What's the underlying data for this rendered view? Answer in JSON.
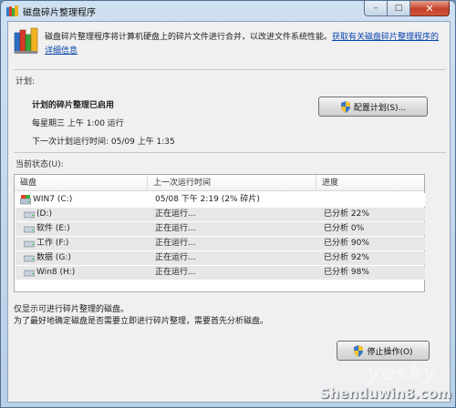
{
  "window": {
    "title": "磁盘碎片整理程序",
    "minimize_label": "–",
    "maximize_label": "□",
    "close_label": "✕"
  },
  "intro": {
    "text": "磁盘碎片整理程序将计算机硬盘上的碎片文件进行合并，以改进文件系统性能。",
    "link": "获取有关磁盘碎片整理程序的详细信息"
  },
  "schedule": {
    "section_label": "计划:",
    "enabled_text": "计划的碎片整理已启用",
    "frequency": "每星期三 上午 1:00 运行",
    "next_run": "下一次计划运行时间: 05/09 上午 1:35",
    "configure_button": "配置计划(S)..."
  },
  "status": {
    "section_label": "当前状态(U):",
    "columns": [
      "磁盘",
      "上一次运行时间",
      "进度"
    ],
    "rows": [
      {
        "disk": "WIN7 (C:)",
        "last_run": "05/08 下午 2:19 (2% 碎片)",
        "progress": ""
      },
      {
        "disk": "(D:)",
        "last_run": "正在运行...",
        "progress": "已分析 22%"
      },
      {
        "disk": "软件 (E:)",
        "last_run": "正在运行...",
        "progress": "已分析 0%"
      },
      {
        "disk": "工作 (F:)",
        "last_run": "正在运行...",
        "progress": "已分析 90%"
      },
      {
        "disk": "数据 (G:)",
        "last_run": "正在运行...",
        "progress": "已分析 92%"
      },
      {
        "disk": "Win8 (H:)",
        "last_run": "正在运行...",
        "progress": "已分析 98%"
      }
    ]
  },
  "footer": {
    "line1": "仅显示可进行碎片整理的磁盘。",
    "line2": "为了最好地确定磁盘是否需要立即进行碎片整理，需要首先分析磁盘。",
    "stop_button": "停止操作(O)"
  },
  "watermark": {
    "site": "Shenduwin8.com",
    "brand": "yesky"
  },
  "colors": {
    "link": "#0645ad",
    "title_bar": "#c4d7ec",
    "close_button": "#c4412a"
  }
}
